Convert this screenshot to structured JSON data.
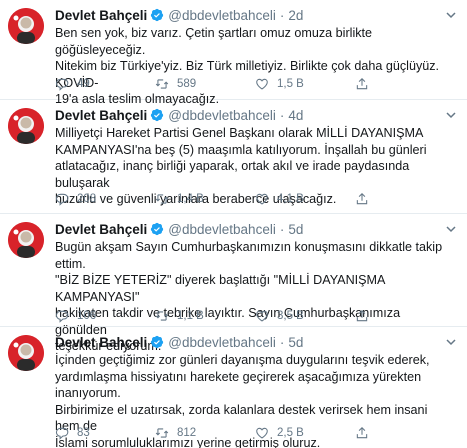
{
  "tweets": [
    {
      "name": "Devlet Bahçeli",
      "handle": "@dbdevletbahceli",
      "separator": "·",
      "time": "2d",
      "text": "Ben sen yok, biz varız. Çetin şartları omuz omuza birlikte göğüsleyeceğiz.\nNitekim biz Türkiye'yiz. Biz Türk milletiyiz. Birlikte çok daha güçlüyüz. KOVİD-\n19'a asla teslim olmayacağız.",
      "replies": "49",
      "retweets": "589",
      "likes": "1,5 B"
    },
    {
      "name": "Devlet Bahçeli",
      "handle": "@dbdevletbahceli",
      "separator": "·",
      "time": "4d",
      "text": "Milliyetçi Hareket Partisi Genel Başkanı olarak MİLLİ DAYANIŞMA\nKAMPANYASI'na beş (5) maaşımla katılıyorum. İnşallah bu günleri\natlatacağız, inanç birliği yaparak, ortak akıl ve irade paydasında buluşarak\nhuzurlu ve güvenli yarınlara beraberce ulaşacağız.",
      "replies": "208",
      "retweets": "1,4 B",
      "likes": "4,1 B"
    },
    {
      "name": "Devlet Bahçeli",
      "handle": "@dbdevletbahceli",
      "separator": "·",
      "time": "5d",
      "text": "Bugün akşam Sayın Cumhurbaşkanımızın konuşmasını dikkatle takip ettim.\n\"BİZ BİZE YETERİZ\" diyerek başlattığı \"MİLLİ DAYANIŞMA KAMPANYASI\"\nhakikaten takdir ve tebrike layıktır. Sayın Cumhurbaşkanımıza gönülden\nteşekkür ediyorum.",
      "replies": "106",
      "retweets": "1,1 B",
      "likes": "3,5 B"
    },
    {
      "name": "Devlet Bahçeli",
      "handle": "@dbdevletbahceli",
      "separator": "·",
      "time": "5d",
      "text": "İçinden geçtiğimiz zor günleri dayanışma duygularını teşvik ederek,\nyardımlaşma hissiyatını harekete geçirerek aşacağımıza yürekten inanıyorum.\nBirbirimize el uzatırsak, zorda kalanlara destek verirsek hem insani hem de\nİslami sorumluluklarımızı yerine getirmiş oluruz.",
      "replies": "83",
      "retweets": "812",
      "likes": "2,5 B"
    }
  ],
  "colors": {
    "verified": "#1da1f2",
    "icon": "#657786",
    "avatar": "#d8232a"
  }
}
